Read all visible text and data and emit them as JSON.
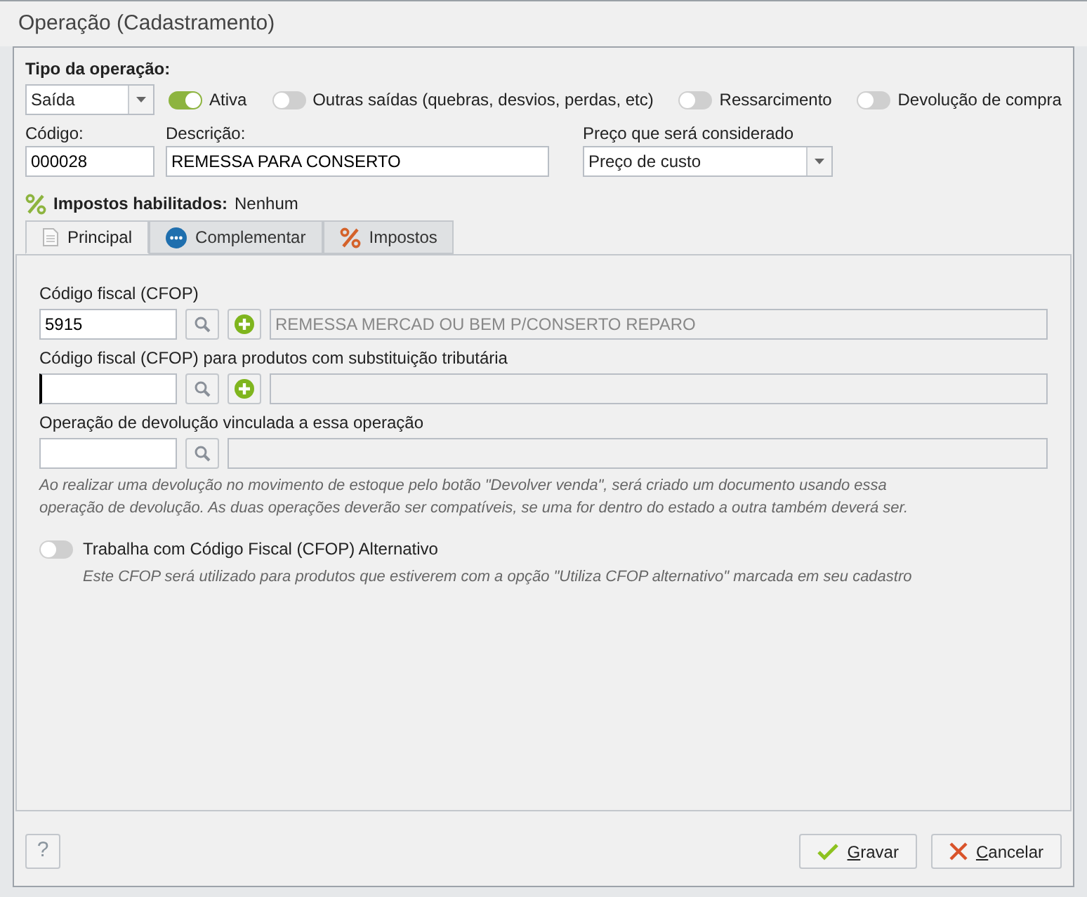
{
  "window": {
    "title": "Operação (Cadastramento)"
  },
  "tipo": {
    "label": "Tipo da operação:",
    "value": "Saída"
  },
  "toggles": [
    {
      "label": "Ativa",
      "on": true
    },
    {
      "label": "Outras saídas (quebras, desvios, perdas, etc)",
      "on": false
    },
    {
      "label": "Ressarcimento",
      "on": false
    },
    {
      "label": "Devolução de compra",
      "on": false
    }
  ],
  "codigo": {
    "label": "Código:",
    "value": "000028"
  },
  "descricao": {
    "label": "Descrição:",
    "value": "REMESSA PARA CONSERTO"
  },
  "preco": {
    "label": "Preço que será considerado",
    "value": "Preço de custo"
  },
  "impostos": {
    "label": "Impostos habilitados:",
    "value": "Nenhum"
  },
  "tabs": [
    {
      "label": "Principal",
      "kind": "doc",
      "selected": true
    },
    {
      "label": "Complementar",
      "kind": "more",
      "selected": false
    },
    {
      "label": "Impostos",
      "kind": "percent",
      "selected": false
    }
  ],
  "lookups": [
    {
      "label": "Código fiscal (CFOP)",
      "value": "5915",
      "add": true,
      "description": "REMESSA MERCAD OU BEM P/CONSERTO REPARO",
      "focused": false
    },
    {
      "label": "Código fiscal (CFOP) para produtos com substituição tributária",
      "add": true,
      "focused": true
    },
    {
      "label": "Operação de devolução vinculada a essa operação",
      "add": false,
      "focused": false
    }
  ],
  "devolucao_note": "Ao realizar uma devolução no movimento de estoque pelo botão \"Devolver venda\", será criado um documento usando essa operação de devolução. As duas operações deverão ser compatíveis, se uma for dentro do estado a outra também deverá ser.",
  "alternativo": {
    "label": "Trabalha com Código Fiscal (CFOP) Alternativo",
    "on": false,
    "note": "Este CFOP será utilizado para produtos que estiverem com a opção \"Utiliza CFOP alternativo\" marcada em seu cadastro"
  },
  "help": "?",
  "buttons": [
    {
      "label": "Gravar",
      "kind": "save"
    },
    {
      "label": "Cancelar",
      "kind": "cancel"
    }
  ]
}
